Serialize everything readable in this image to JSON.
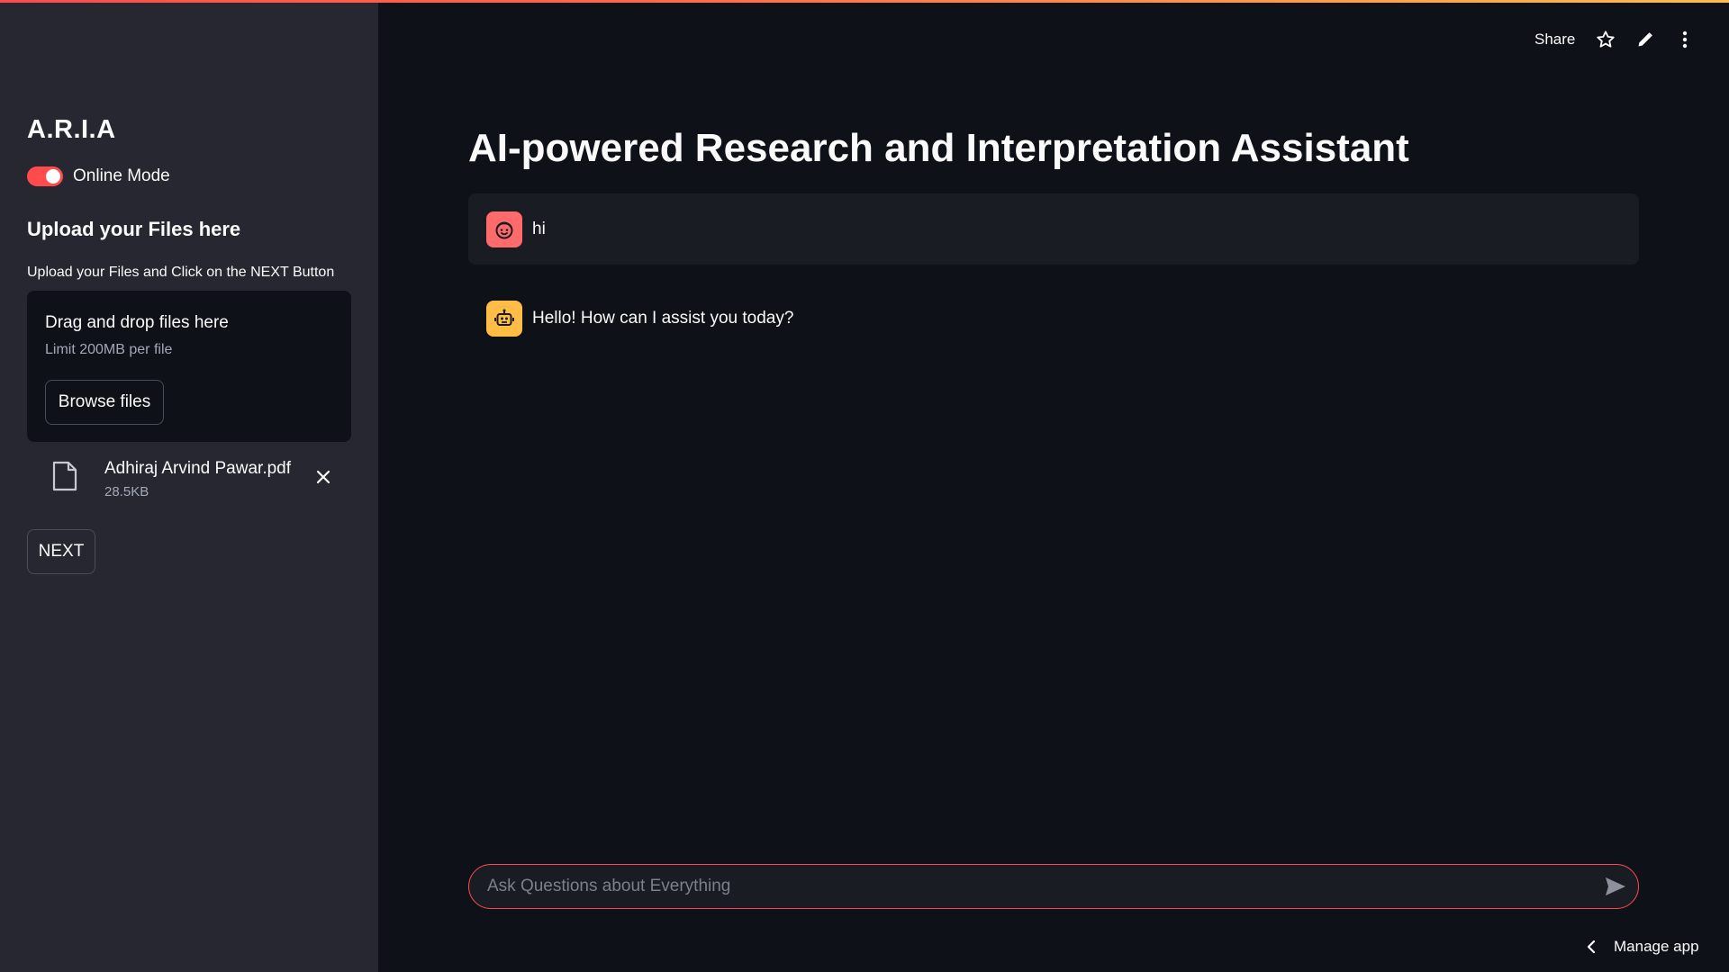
{
  "sidebar": {
    "app_title": "A.R.I.A",
    "toggle": {
      "label": "Online Mode",
      "on": true
    },
    "upload_heading": "Upload your Files here",
    "upload_instruction": "Upload your Files and Click on the NEXT Button",
    "dropzone": {
      "title": "Drag and drop files here",
      "limit": "Limit 200MB per file",
      "browse_label": "Browse files"
    },
    "uploaded_file": {
      "name": "Adhiraj Arvind Pawar.pdf",
      "size": "28.5KB"
    },
    "next_label": "NEXT"
  },
  "header": {
    "share_label": "Share",
    "icons": [
      "star-icon",
      "pencil-icon",
      "more-vertical-icon"
    ]
  },
  "main": {
    "title": "AI-powered Research and Interpretation Assistant",
    "messages": [
      {
        "role": "user",
        "text": "hi",
        "avatar_icon": "user-face-icon"
      },
      {
        "role": "assistant",
        "text": "Hello! How can I assist you today?",
        "avatar_icon": "robot-icon"
      }
    ],
    "chat_input": {
      "placeholder": "Ask Questions about Everything",
      "value": ""
    }
  },
  "footer": {
    "manage_label": "Manage app"
  },
  "colors": {
    "accent": "#ff4b4b",
    "background": "#0e1117",
    "sidebar": "#262730",
    "user_avatar": "#ff6b6b",
    "bot_avatar": "#ffbd45"
  }
}
